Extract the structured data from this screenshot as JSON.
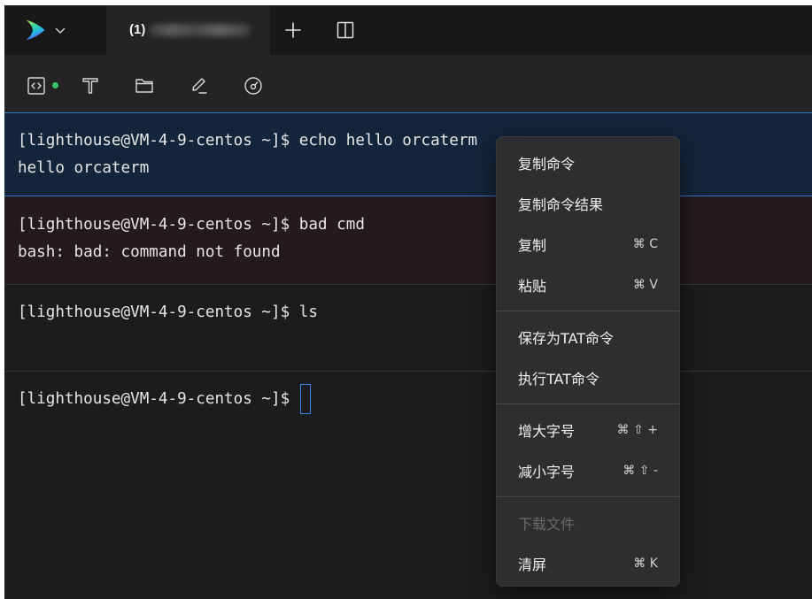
{
  "tabbar": {
    "logo_icon": "orcaterm-logo-icon",
    "menu_icon": "chevron-down-icon",
    "tabs": [
      {
        "label": "(1)",
        "active": true
      }
    ],
    "new_tab_icon": "plus-icon",
    "split_icon": "split-view-icon"
  },
  "toolbar": {
    "icons": [
      "code-icon",
      "text-icon",
      "folder-icon",
      "pencil-icon",
      "gauge-icon"
    ]
  },
  "terminal": {
    "blocks": [
      {
        "prompt": "[lighthouse@VM-4-9-centos ~]$",
        "command": "echo hello orcaterm",
        "output": "hello orcaterm",
        "selected": true
      },
      {
        "prompt": "[lighthouse@VM-4-9-centos ~]$",
        "command": "bad cmd",
        "output": "bash: bad: command not found",
        "error": true
      },
      {
        "prompt": "[lighthouse@VM-4-9-centos ~]$",
        "command": "ls"
      },
      {
        "prompt": "[lighthouse@VM-4-9-centos ~]$",
        "active": true
      }
    ]
  },
  "context_menu": {
    "groups": [
      {
        "items": [
          {
            "label": "复制命令"
          },
          {
            "label": "复制命令结果"
          },
          {
            "label": "复制",
            "shortcut": "⌘ C"
          },
          {
            "label": "粘贴",
            "shortcut": "⌘ V"
          }
        ]
      },
      {
        "items": [
          {
            "label": "保存为TAT命令"
          },
          {
            "label": "执行TAT命令"
          }
        ]
      },
      {
        "items": [
          {
            "label": "增大字号",
            "shortcut": "⌘ ⇧ +"
          },
          {
            "label": "减小字号",
            "shortcut": "⌘ ⇧ -"
          }
        ]
      },
      {
        "items": [
          {
            "label": "下载文件",
            "disabled": true
          },
          {
            "label": "清屏",
            "shortcut": "⌘ K"
          }
        ]
      }
    ]
  },
  "colors": {
    "window_bg": "#1c1c1c",
    "tabbar_bg": "#181818",
    "toolbar_bg": "#242424",
    "selected_block_bg": "#13253a",
    "selected_block_border": "#3574c4",
    "error_block_bg": "#221a1b",
    "cursor": "#3a86ea",
    "status_dot": "#3ec46d",
    "menu_bg": "#2e2e30",
    "disabled_text": "#6b6b6d"
  }
}
